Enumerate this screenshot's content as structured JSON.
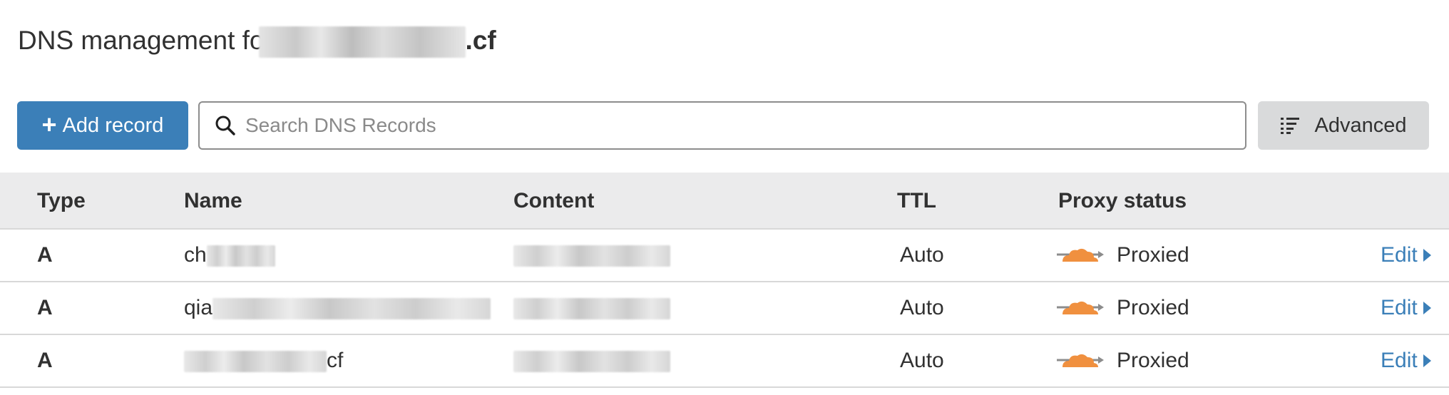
{
  "page": {
    "title_prefix": "DNS management fo",
    "title_suffix": ".cf"
  },
  "toolbar": {
    "add_label": "Add record",
    "add_icon": "plus-icon",
    "search_placeholder": "Search DNS Records",
    "search_icon": "search-icon",
    "advanced_label": "Advanced",
    "advanced_icon": "list-filter-icon"
  },
  "colors": {
    "primary": "#3b7fb8",
    "cloud": "#f0903f",
    "header_bg": "#ebebec"
  },
  "table": {
    "headers": [
      "Type",
      "Name",
      "Content",
      "TTL",
      "Proxy status"
    ],
    "rows": [
      {
        "type": "A",
        "name": "ch",
        "name_suffix": "",
        "content": "",
        "ttl": "Auto",
        "proxy": "Proxied",
        "action": "Edit"
      },
      {
        "type": "A",
        "name": "qia",
        "name_suffix": "",
        "content": "",
        "ttl": "Auto",
        "proxy": "Proxied",
        "action": "Edit"
      },
      {
        "type": "A",
        "name": "",
        "name_suffix": "cf",
        "content": "",
        "ttl": "Auto",
        "proxy": "Proxied",
        "action": "Edit"
      }
    ]
  }
}
